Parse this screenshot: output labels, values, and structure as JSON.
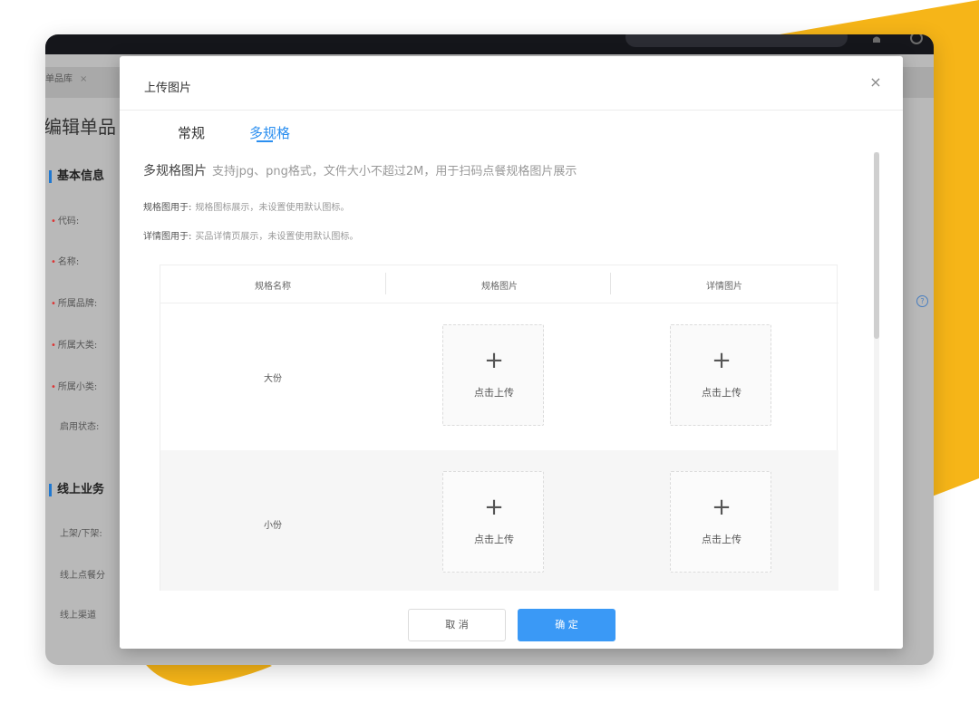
{
  "colors": {
    "accent": "#2b8ff0",
    "primary_button": "#3a99f6",
    "decor_yellow": "#f6b518",
    "topbar": "#15161b"
  },
  "background_app": {
    "page_tab": {
      "label": "单品库",
      "close": "×"
    },
    "page_title": "编辑单品",
    "sections": [
      {
        "heading": "基本信息"
      },
      {
        "heading": "线上业务"
      }
    ],
    "fields": [
      {
        "label": "代码:",
        "required": true
      },
      {
        "label": "名称:",
        "required": true
      },
      {
        "label": "所属品牌:",
        "required": true
      },
      {
        "label": "所属大类:",
        "required": true
      },
      {
        "label": "所属小类:",
        "required": true
      },
      {
        "label": "启用状态:",
        "required": false
      }
    ],
    "online_fields": [
      {
        "label": "上架/下架:"
      },
      {
        "label": "线上点餐分"
      },
      {
        "label": "线上渠道"
      }
    ]
  },
  "modal": {
    "title": "上传图片",
    "close_icon": "×",
    "tabs": [
      {
        "label": "常规",
        "active": false
      },
      {
        "label": "多规格",
        "active": true
      }
    ],
    "intro_title": "多规格图片",
    "intro_hint": "支持jpg、png格式，文件大小不超过2M，用于扫码点餐规格图片展示",
    "notes": [
      {
        "label": "规格图用于:",
        "text": "规格图标展示，未设置使用默认图标。"
      },
      {
        "label": "详情图用于:",
        "text": "买品详情页展示，未设置使用默认图标。"
      }
    ],
    "table": {
      "headers": [
        "规格名称",
        "规格图片",
        "详情图片"
      ],
      "rows": [
        {
          "name": "大份",
          "spec_upload": "点击上传",
          "detail_upload": "点击上传"
        },
        {
          "name": "小份",
          "spec_upload": "点击上传",
          "detail_upload": "点击上传"
        }
      ],
      "plus_glyph": "+"
    },
    "buttons": {
      "cancel": "取 消",
      "ok": "确 定"
    }
  }
}
